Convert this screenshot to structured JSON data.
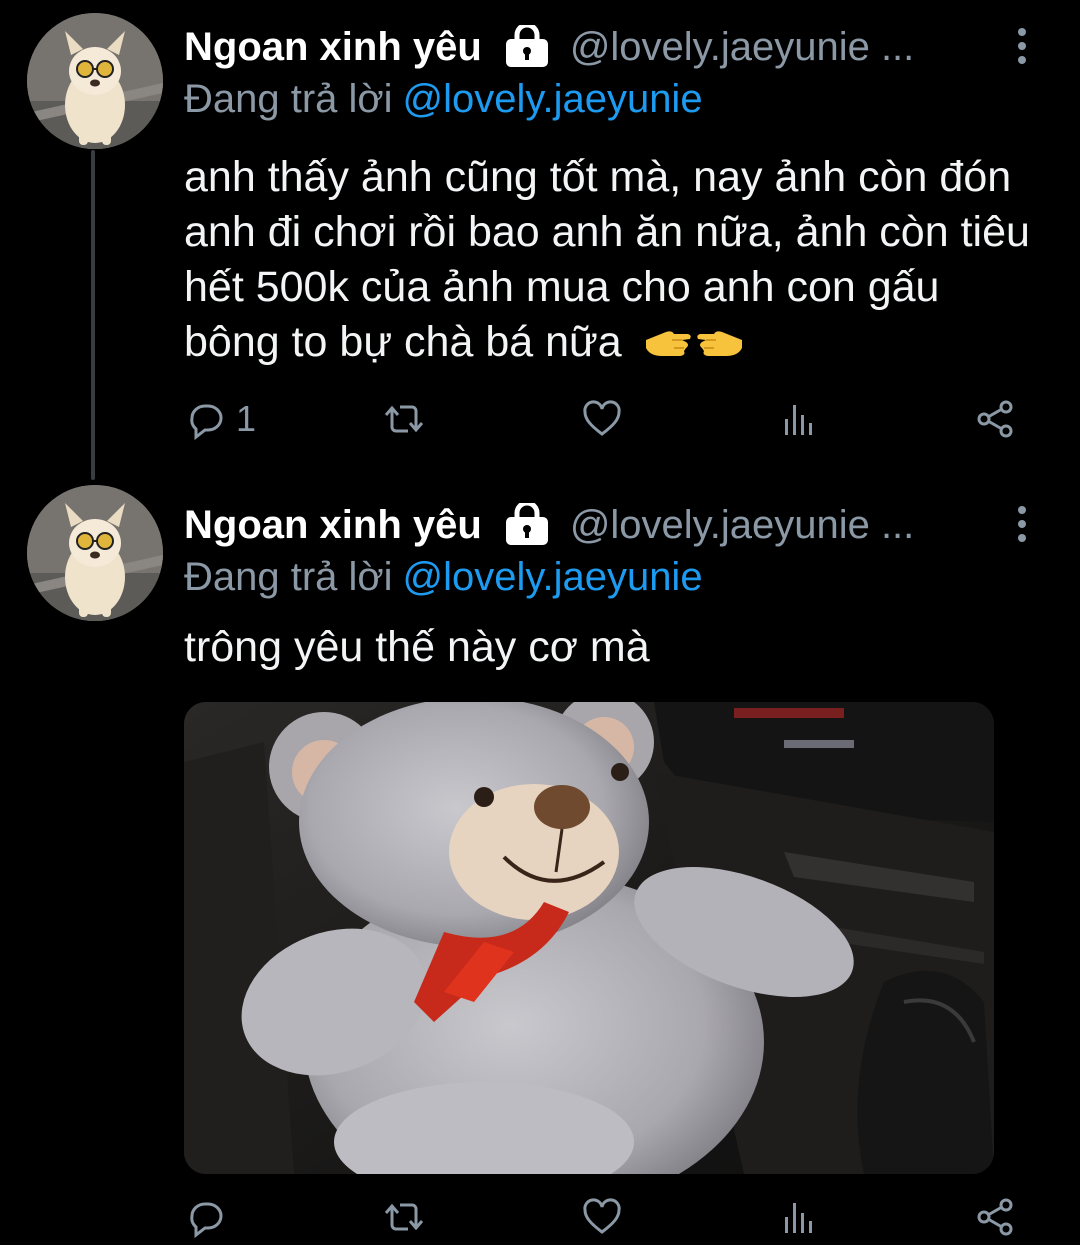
{
  "tweets": [
    {
      "author_name": "Ngoan xinh yêu",
      "handle": "@lovely.jaeyunie ...",
      "reply_label": "Đang trả lời",
      "reply_mention": "@lovely.jaeyunie",
      "text": "anh thấy ảnh cũng tốt mà, nay ảnh còn đón anh đi chơi rồi bao anh ăn nữa, ảnh còn tiêu hết 500k của ảnh mua cho anh con gấu bông to bự chà bá nữa",
      "reply_count": "1"
    },
    {
      "author_name": "Ngoan xinh yêu",
      "handle": "@lovely.jaeyunie ...",
      "reply_label": "Đang trả lời",
      "reply_mention": "@lovely.jaeyunie",
      "text": "trông yêu thế này cơ mà",
      "reply_count": ""
    }
  ],
  "icons": {
    "lock": "lock-icon",
    "more": "more-vertical-icon",
    "reply": "reply-icon",
    "retweet": "retweet-icon",
    "like": "heart-icon",
    "views": "views-icon",
    "share": "share-icon",
    "emoji": "pointing-hands-emoji"
  },
  "colors": {
    "background": "#000000",
    "secondary_text": "#8b98a5",
    "mention": "#1d9bf0",
    "thread_line": "#3a3d40"
  }
}
